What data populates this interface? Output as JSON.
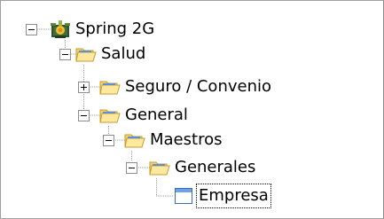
{
  "tree": {
    "nodes": [
      {
        "label": "Spring 2G",
        "icon": "spring-app-icon",
        "expander": "minus"
      },
      {
        "label": "Salud",
        "icon": "folder-open-icon",
        "expander": "minus"
      },
      {
        "label": "Seguro / Convenio",
        "icon": "folder-open-icon",
        "expander": "plus"
      },
      {
        "label": "General",
        "icon": "folder-open-icon",
        "expander": "minus"
      },
      {
        "label": "Maestros",
        "icon": "folder-open-icon",
        "expander": "minus"
      },
      {
        "label": "Generales",
        "icon": "folder-open-icon",
        "expander": "minus"
      },
      {
        "label": "Empresa",
        "icon": "window-form-icon",
        "expander": "none"
      }
    ]
  },
  "colors": {
    "folder_fill": "#f6d36a",
    "folder_dark": "#c89b2a",
    "folder_blue": "#5b8fd8",
    "guide_dots": "#9a9a9a",
    "expander_border": "#8c8c8c",
    "window_border": "#3a6bc0",
    "window_title": "#6ea0e8"
  }
}
